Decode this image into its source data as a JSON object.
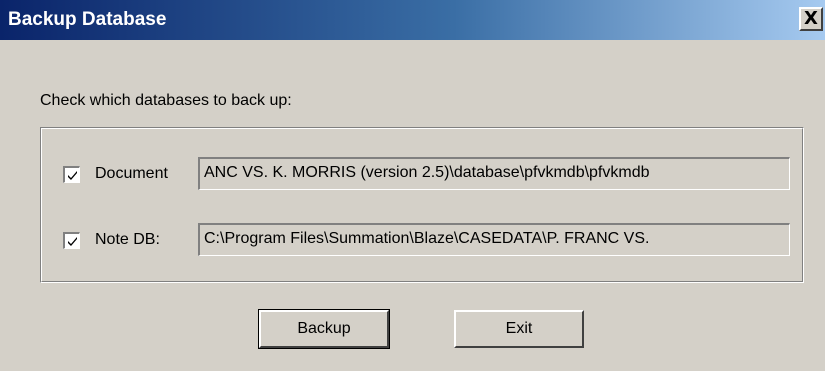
{
  "window": {
    "title": "Backup Database",
    "close_glyph": "X"
  },
  "instructions": "Check which databases to back up:",
  "databases": [
    {
      "label": "Document",
      "checked": true,
      "path": "ANC VS. K. MORRIS (version 2.5)\\database\\pfvkmdb\\pfvkmdb"
    },
    {
      "label": "Note DB:",
      "checked": true,
      "path": "C:\\Program Files\\Summation\\Blaze\\CASEDATA\\P. FRANC VS."
    }
  ],
  "buttons": {
    "backup_label": "Backup",
    "exit_label": "Exit"
  },
  "colors": {
    "title_gradient_start": "#0a246a",
    "title_gradient_end": "#a6caf0",
    "face": "#d4d0c8"
  }
}
